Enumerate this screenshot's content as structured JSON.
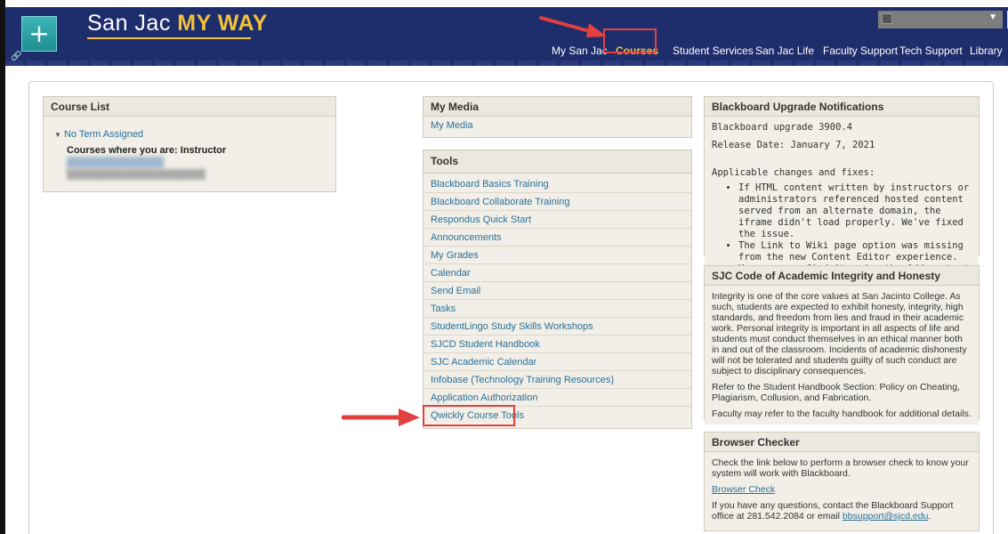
{
  "header": {
    "brand_prefix": "San Jac",
    "brand_highlight": "MY WAY",
    "nav": [
      {
        "label": "My San Jac"
      },
      {
        "label": "Courses"
      },
      {
        "label": "Student Services"
      },
      {
        "label": "San Jac Life"
      },
      {
        "label": "Faculty Support"
      },
      {
        "label": "Tech Support"
      },
      {
        "label": "Library"
      }
    ]
  },
  "course_list": {
    "title": "Course List",
    "term": "No Term Assigned",
    "subheading": "Courses where you are: Instructor"
  },
  "my_media": {
    "title": "My Media",
    "link": "My Media"
  },
  "tools": {
    "title": "Tools",
    "items": [
      "Blackboard Basics Training",
      "Blackboard Collaborate Training",
      "Respondus Quick Start",
      "Announcements",
      "My Grades",
      "Calendar",
      "Send Email",
      "Tasks",
      "StudentLingo Study Skills Workshops",
      "SJCD Student Handbook",
      "SJC Academic Calendar",
      "Infobase (Technology Training Resources)",
      "Application Authorization",
      "Qwickly Course Tools"
    ]
  },
  "upgrade": {
    "title": "Blackboard Upgrade Notifications",
    "version": "Blackboard upgrade 3900.4",
    "release": "Release Date: January 7, 2021",
    "changes_heading": "Applicable changes and fixes:",
    "bullet1": "If HTML content written by instructors or administrators referenced hosted content served from an alternate domain, the iframe didn't load properly. We've fixed the issue.",
    "bullet2": "The Link to Wiki page option was missing from the new Content Editor experience. You can now find it under the Add content dialog."
  },
  "integrity": {
    "title": "SJC Code of Academic Integrity and Honesty",
    "p1": "Integrity is one of the core values at San Jacinto College.  As such, students are expected to exhibit honesty, integrity, high standards, and freedom from lies and fraud in their academic work.  Personal integrity is important in all aspects of life and students must conduct themselves in an ethical manner both in and out of the classroom.  Incidents of academic dishonesty will not be tolerated and students guilty of such conduct are subject to disciplinary consequences.",
    "p2": "Refer to the Student Handbook Section: Policy on Cheating, Plagiarism, Collusion, and Fabrication.",
    "p3": "Faculty may refer to the faculty handbook for additional details."
  },
  "browser": {
    "title": "Browser Checker",
    "p1": "Check the link below to perform a browser check to know your system will work with Blackboard.",
    "link": "Browser Check",
    "p2_prefix": "If you have any questions, contact the Blackboard Support office at 281.542.2084 or email ",
    "email": "bbsupport@sjcd.edu",
    "p2_suffix": "."
  },
  "colors": {
    "header_bg": "#1e2d6b",
    "accent": "#f3c23b",
    "link": "#2b6f9a",
    "highlight_box": "#e34040"
  }
}
